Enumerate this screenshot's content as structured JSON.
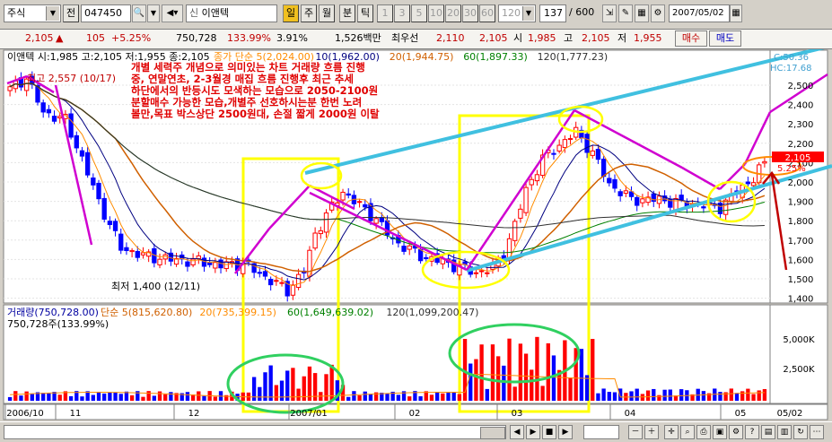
{
  "toolbar": {
    "market_type": "주식",
    "prev_label": "전",
    "code": "047450",
    "stock_name": "이앤텍",
    "credit_label": "신",
    "period_buttons": [
      "일",
      "주",
      "월",
      "분",
      "틱"
    ],
    "interval_buttons": [
      "1",
      "3",
      "5",
      "10",
      "20",
      "30",
      "60",
      "120"
    ],
    "view_count": "137",
    "total_count": "/ 600",
    "date": "2007/05/02"
  },
  "quote": {
    "price": "2,105",
    "arrow": "▲",
    "change": "105",
    "change_pct": "+5.25%",
    "volume": "750,728",
    "volume_ratio": "133.99%",
    "turnover": "3.91%",
    "amount": "1,526백만",
    "ask_label": "최우선",
    "ask1": "2,110",
    "bid1": "2,105",
    "open_label": "시",
    "open": "1,985",
    "high_label": "고",
    "high": "2,105",
    "low_label": "저",
    "low": "1,955",
    "buy_button": "매수",
    "sell_button": "매도"
  },
  "price_panel": {
    "ohlc_legend": "이앤텍 시:1,985 고:2,105 저:1,955 종:2,105",
    "ma_legend": [
      "종가 단순 5(2,024.00)",
      "10(1,962.00)",
      "20(1,944.75)",
      "60(1,897.33)",
      "120(1,777.23)"
    ],
    "high_marker": "최고 2,557 (10/17)",
    "low_marker": "최저 1,400 (12/11)",
    "annotation_lines": [
      "개별 세력주 개념으로 의미있는 차트 거래량 흐름 진행",
      "중, 연말연초, 2-3월경 매집 흐름 진행후 최근 추세",
      "하단에서의 반등시도 모색하는 모습으로 2050-2100원",
      "분할매수 가능한 모습,개별주 선호하시는분 한번 노려",
      "볼만,목표 박스상단 2500원대, 손절 짧게 2000원 이탈"
    ],
    "y_axis_labels": [
      "2,500",
      "2,400",
      "2,300",
      "2,200",
      "2,100",
      "2,000",
      "1,900",
      "1,800",
      "1,700",
      "1,600",
      "1,500",
      "1,400"
    ],
    "corner_labels": [
      "C:50.36",
      "HC:17.68"
    ],
    "price_tag": "2,105",
    "pct_tag": "5.25%"
  },
  "volume_panel": {
    "legend": [
      "거래량(750,728.00)",
      "단순 5(815,620.80)",
      "20(735,399.15)",
      "60(1,649,639.02)",
      "120(1,099,200.47)"
    ],
    "sub_legend": "750,728주(133.99%)",
    "y_axis_labels": [
      "5,000K",
      "2,500K"
    ]
  },
  "x_axis_labels": [
    "2006/10",
    "11",
    "12",
    "2007/01",
    "02",
    "03",
    "04",
    "05",
    "05/02"
  ],
  "colors": {
    "up": "#ff0000",
    "down": "#0000ff",
    "ma5": "#ff8c00",
    "ma10": "#000080",
    "ma20": "#d06000",
    "ma60": "#008000",
    "ma120": "#303030",
    "highlight": "#ffff00",
    "trendline": "#40c0e0",
    "drawn": "#d000d0",
    "circle_green": "#30d060",
    "arrow": "#c00000"
  }
}
